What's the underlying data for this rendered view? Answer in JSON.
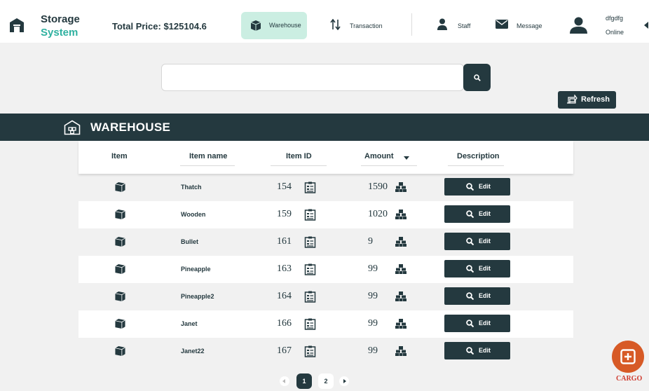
{
  "brand": {
    "line1": "Storage",
    "line2": "System"
  },
  "header": {
    "total_price": "Total Price: $125104.6",
    "nav": {
      "warehouse": "Warehouse",
      "transaction": "Transaction",
      "staff": "Staff",
      "message": "Message"
    },
    "user": {
      "name": "dfgdfg",
      "status": "Online"
    }
  },
  "search": {
    "value": "",
    "placeholder": ""
  },
  "refresh_label": "Refresh",
  "section_title": "WAREHOUSE",
  "table": {
    "columns": [
      "Item",
      "Item name",
      "Item ID",
      "Amount",
      "Description"
    ],
    "edit_label": "Edit",
    "rows": [
      {
        "name": "Thatch",
        "id": "154",
        "amount": "1590"
      },
      {
        "name": "Wooden",
        "id": "159",
        "amount": "1020"
      },
      {
        "name": "Bullet",
        "id": "161",
        "amount": "9"
      },
      {
        "name": "Pineapple",
        "id": "163",
        "amount": "99"
      },
      {
        "name": "Pineapple2",
        "id": "164",
        "amount": "99"
      },
      {
        "name": "Janet",
        "id": "166",
        "amount": "99"
      },
      {
        "name": "Janet22",
        "id": "167",
        "amount": "99"
      }
    ]
  },
  "pagination": {
    "pages": [
      "1",
      "2"
    ],
    "current": "1"
  },
  "cargo_label": "CARGO",
  "colors": {
    "primary": "#24393f",
    "accent": "#2fb1a0",
    "active_nav": "#cbeee2",
    "cargo": "#d75a26"
  }
}
